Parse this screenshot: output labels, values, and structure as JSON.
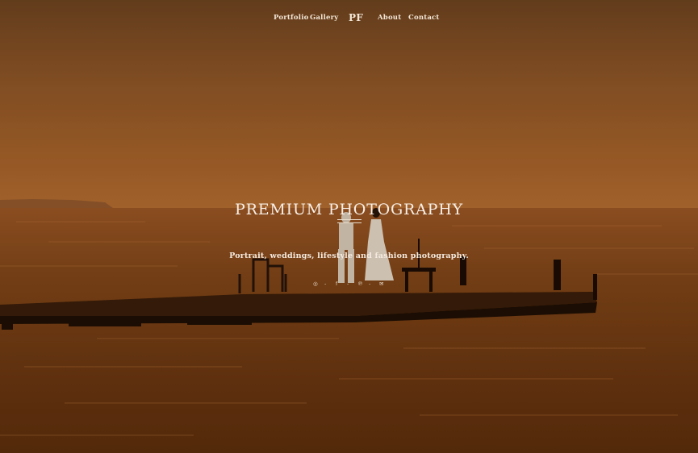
{
  "nav": {
    "portfolio": "Portfolio",
    "gallery": "Gallery",
    "logo": "PF",
    "about": "About",
    "contact": "Contact"
  },
  "hero": {
    "title": "PREMIUM PHOTOGRAPHY",
    "tagline": "Portrait, weddings, lifestyle and fashion photography."
  },
  "social": {
    "icons": [
      "instagram-icon",
      "facebook-icon",
      "pinterest-icon",
      "email-icon"
    ],
    "separator": "-"
  },
  "colors": {
    "sky_top": "#8a5522",
    "sky_horizon": "#b06a2e",
    "water": "#7a3e12",
    "text": "#f8efe6"
  }
}
